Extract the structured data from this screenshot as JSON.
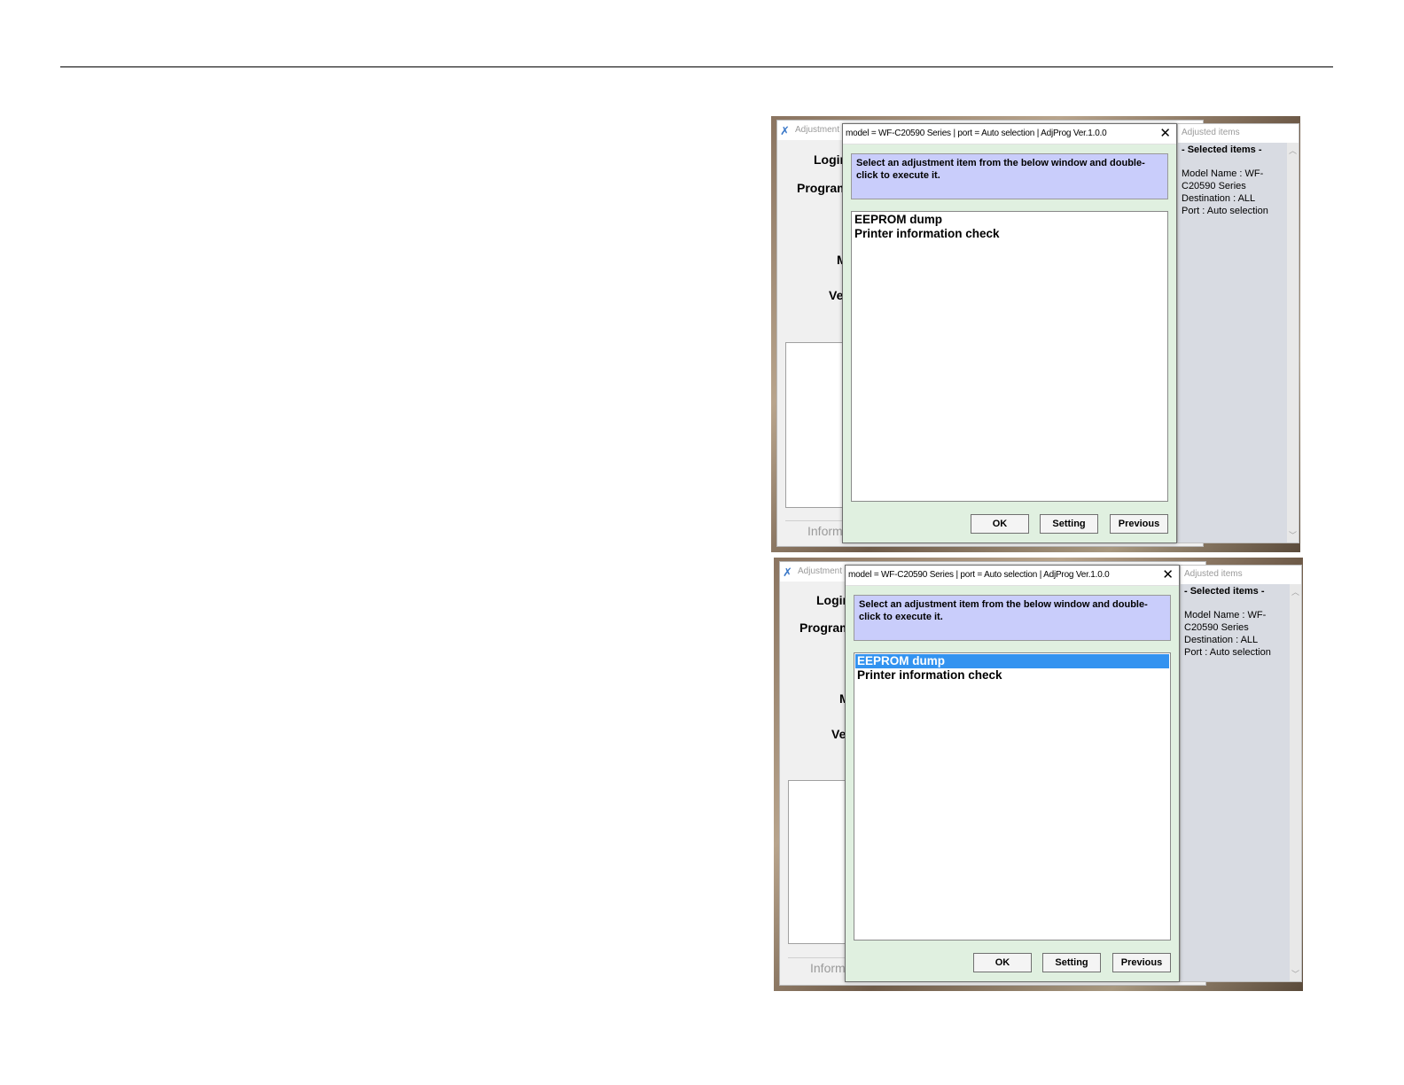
{
  "screens": [
    {
      "background_window": {
        "title": "Adjustment P",
        "login_label": "Login",
        "program_label": "Program",
        "m_label": "M",
        "ve_label": "Ve",
        "info_label": "Inform"
      },
      "adjusted_panel": {
        "header": "Adjusted items",
        "selected_title": "- Selected items -",
        "model_line1": "Model Name : WF-",
        "model_line2": "C20590 Series",
        "destination": "Destination : ALL",
        "port": "Port : Auto selection"
      },
      "dialog": {
        "title": "model = WF-C20590 Series | port = Auto selection | AdjProg Ver.1.0.0",
        "close_glyph": "✕",
        "instruction": "Select an adjustment item from the below window and double-click to execute it.",
        "items": [
          "EEPROM dump",
          "Printer information check"
        ],
        "selected_index": -1,
        "buttons": {
          "ok": "OK",
          "setting": "Setting",
          "previous": "Previous"
        }
      }
    },
    {
      "background_window": {
        "title": "Adjustment P",
        "login_label": "Login",
        "program_label": "Program",
        "m_label": "M",
        "ve_label": "Ve",
        "info_label": "Inform"
      },
      "adjusted_panel": {
        "header": "Adjusted items",
        "selected_title": "- Selected items -",
        "model_line1": "Model Name : WF-",
        "model_line2": "C20590 Series",
        "destination": "Destination : ALL",
        "port": "Port : Auto selection"
      },
      "dialog": {
        "title": "model = WF-C20590 Series | port = Auto selection | AdjProg Ver.1.0.0",
        "close_glyph": "✕",
        "instruction": "Select an adjustment item from the below window and double-click to execute it.",
        "items": [
          "EEPROM dump",
          "Printer information check"
        ],
        "selected_index": 0,
        "buttons": {
          "ok": "OK",
          "setting": "Setting",
          "previous": "Previous"
        }
      }
    }
  ],
  "colors": {
    "dialog_bg": "#e0f0e0",
    "instruction_bg": "#c9cdfb",
    "selection": "#3393f0",
    "panel_bg": "#d8dbe2"
  },
  "icons": {
    "app": "app-icon",
    "close": "close-icon",
    "scroll_up": "scroll-up-icon",
    "scroll_down": "scroll-down-icon"
  }
}
